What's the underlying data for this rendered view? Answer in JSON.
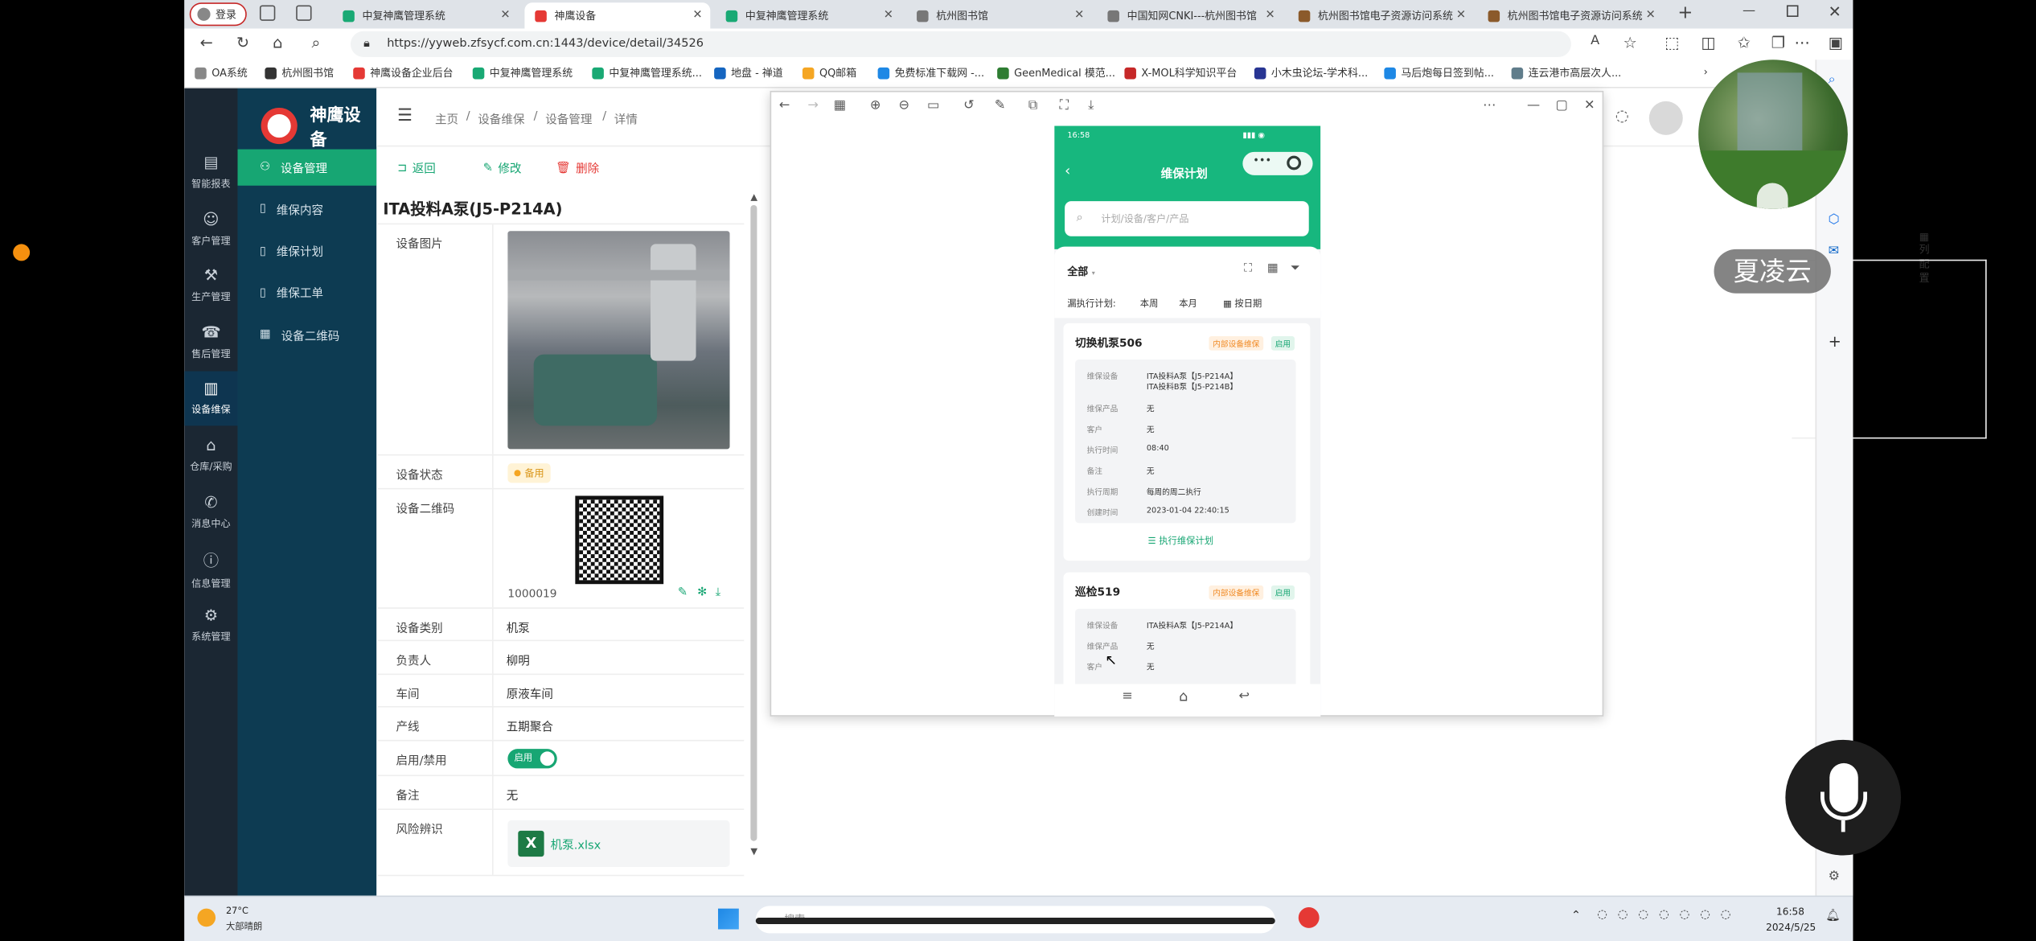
{
  "browser": {
    "login_label": "登录",
    "tabs": [
      {
        "label": "中复神鹰管理系统",
        "active": false,
        "color": "#19a974"
      },
      {
        "label": "神鹰设备",
        "active": true,
        "color": "#e53935"
      },
      {
        "label": "中复神鹰管理系统",
        "active": false,
        "color": "#19a974"
      },
      {
        "label": "杭州图书馆",
        "active": false,
        "color": "#777777"
      },
      {
        "label": "中国知网CNKI---杭州图书馆",
        "active": false,
        "color": "#777777"
      },
      {
        "label": "杭州图书馆电子资源访问系统",
        "active": false,
        "color": "#8b5a2b"
      },
      {
        "label": "杭州图书馆电子资源访问系统",
        "active": false,
        "color": "#8b5a2b"
      }
    ],
    "url": "https://yyweb.zfsycf.com.cn:1443/device/detail/34526",
    "bookmarks": [
      "OA系统",
      "杭州图书馆",
      "神鹰设备企业后台",
      "中复神鹰管理系统",
      "中复神鹰管理系统...",
      "地盘 - 禅道",
      "QQ邮箱",
      "免费标准下载网 -...",
      "GeenMedical 模范...",
      "X-MOL科学知识平台",
      "小木虫论坛-学术科...",
      "马后炮每日签到帖...",
      "连云港市高层次人..."
    ]
  },
  "app": {
    "brand": "神鹰设备",
    "left_nav": [
      "智能报表",
      "客户管理",
      "生产管理",
      "售后管理",
      "设备维保",
      "仓库/采购",
      "消息中心",
      "信息管理",
      "系统管理"
    ],
    "sub_nav": [
      "设备管理",
      "维保内容",
      "维保计划",
      "维保工单",
      "设备二维码"
    ],
    "breadcrumb": [
      "主页",
      "设备维保",
      "设备管理",
      "详情"
    ],
    "actions": {
      "back": "返回",
      "edit": "修改",
      "delete": "删除"
    },
    "device_title": "ITA投料A泵(J5-P214A)",
    "fields": {
      "image_label": "设备图片",
      "status_label": "设备状态",
      "status_value": "备用",
      "qr_label": "设备二维码",
      "qr_number": "1000019",
      "type_label": "设备类别",
      "type_value": "机泵",
      "owner_label": "负责人",
      "owner_value": "柳明",
      "workshop_label": "车间",
      "workshop_value": "原液车间",
      "line_label": "产线",
      "line_value": "五期聚合",
      "enable_label": "启用/禁用",
      "enable_value": "启用",
      "remark_label": "备注",
      "remark_value": "无",
      "risk_label": "风险辨识",
      "risk_file": "机泵.xlsx"
    },
    "right_panel": {
      "column_config": "列配置"
    }
  },
  "phone": {
    "status_time": "16:58",
    "title": "维保计划",
    "search_placeholder": "计划/设备/客户/产品",
    "filter_all": "全部",
    "due_label": "漏执行计划:",
    "due_week": "本周",
    "due_month": "本月",
    "due_date": "按日期",
    "cards": [
      {
        "name": "切换机泵506",
        "tag1": "内部设备维保",
        "tag2": "启用",
        "rows": [
          {
            "k": "维保设备",
            "v": "ITA投料A泵【J5-P214A】"
          },
          {
            "k": "",
            "v": "ITA投料B泵【J5-P214B】"
          },
          {
            "k": "维保产品",
            "v": "无"
          },
          {
            "k": "客户",
            "v": "无"
          },
          {
            "k": "执行时间",
            "v": "08:40"
          },
          {
            "k": "备注",
            "v": "无"
          },
          {
            "k": "执行周期",
            "v": "每周的周二执行"
          },
          {
            "k": "创建时间",
            "v": "2023-01-04 22:40:15"
          }
        ],
        "action": "执行维保计划"
      },
      {
        "name": "巡检519",
        "tag1": "内部设备维保",
        "tag2": "启用",
        "rows": [
          {
            "k": "维保设备",
            "v": "ITA投料A泵【J5-P214A】"
          },
          {
            "k": "维保产品",
            "v": "无"
          },
          {
            "k": "客户",
            "v": "无"
          }
        ]
      }
    ]
  },
  "overlay": {
    "speaker_name": "夏凌云"
  },
  "taskbar": {
    "weather_temp": "27°C",
    "weather_text": "大部晴朗",
    "search_placeholder": "搜索",
    "time": "16:58",
    "date": "2024/5/25"
  },
  "colors": {
    "accent": "#17a673",
    "dark_nav": "#1b2733",
    "sub_nav": "#0d3b52",
    "delete": "#e53935",
    "status_badge": "#f5a623"
  }
}
